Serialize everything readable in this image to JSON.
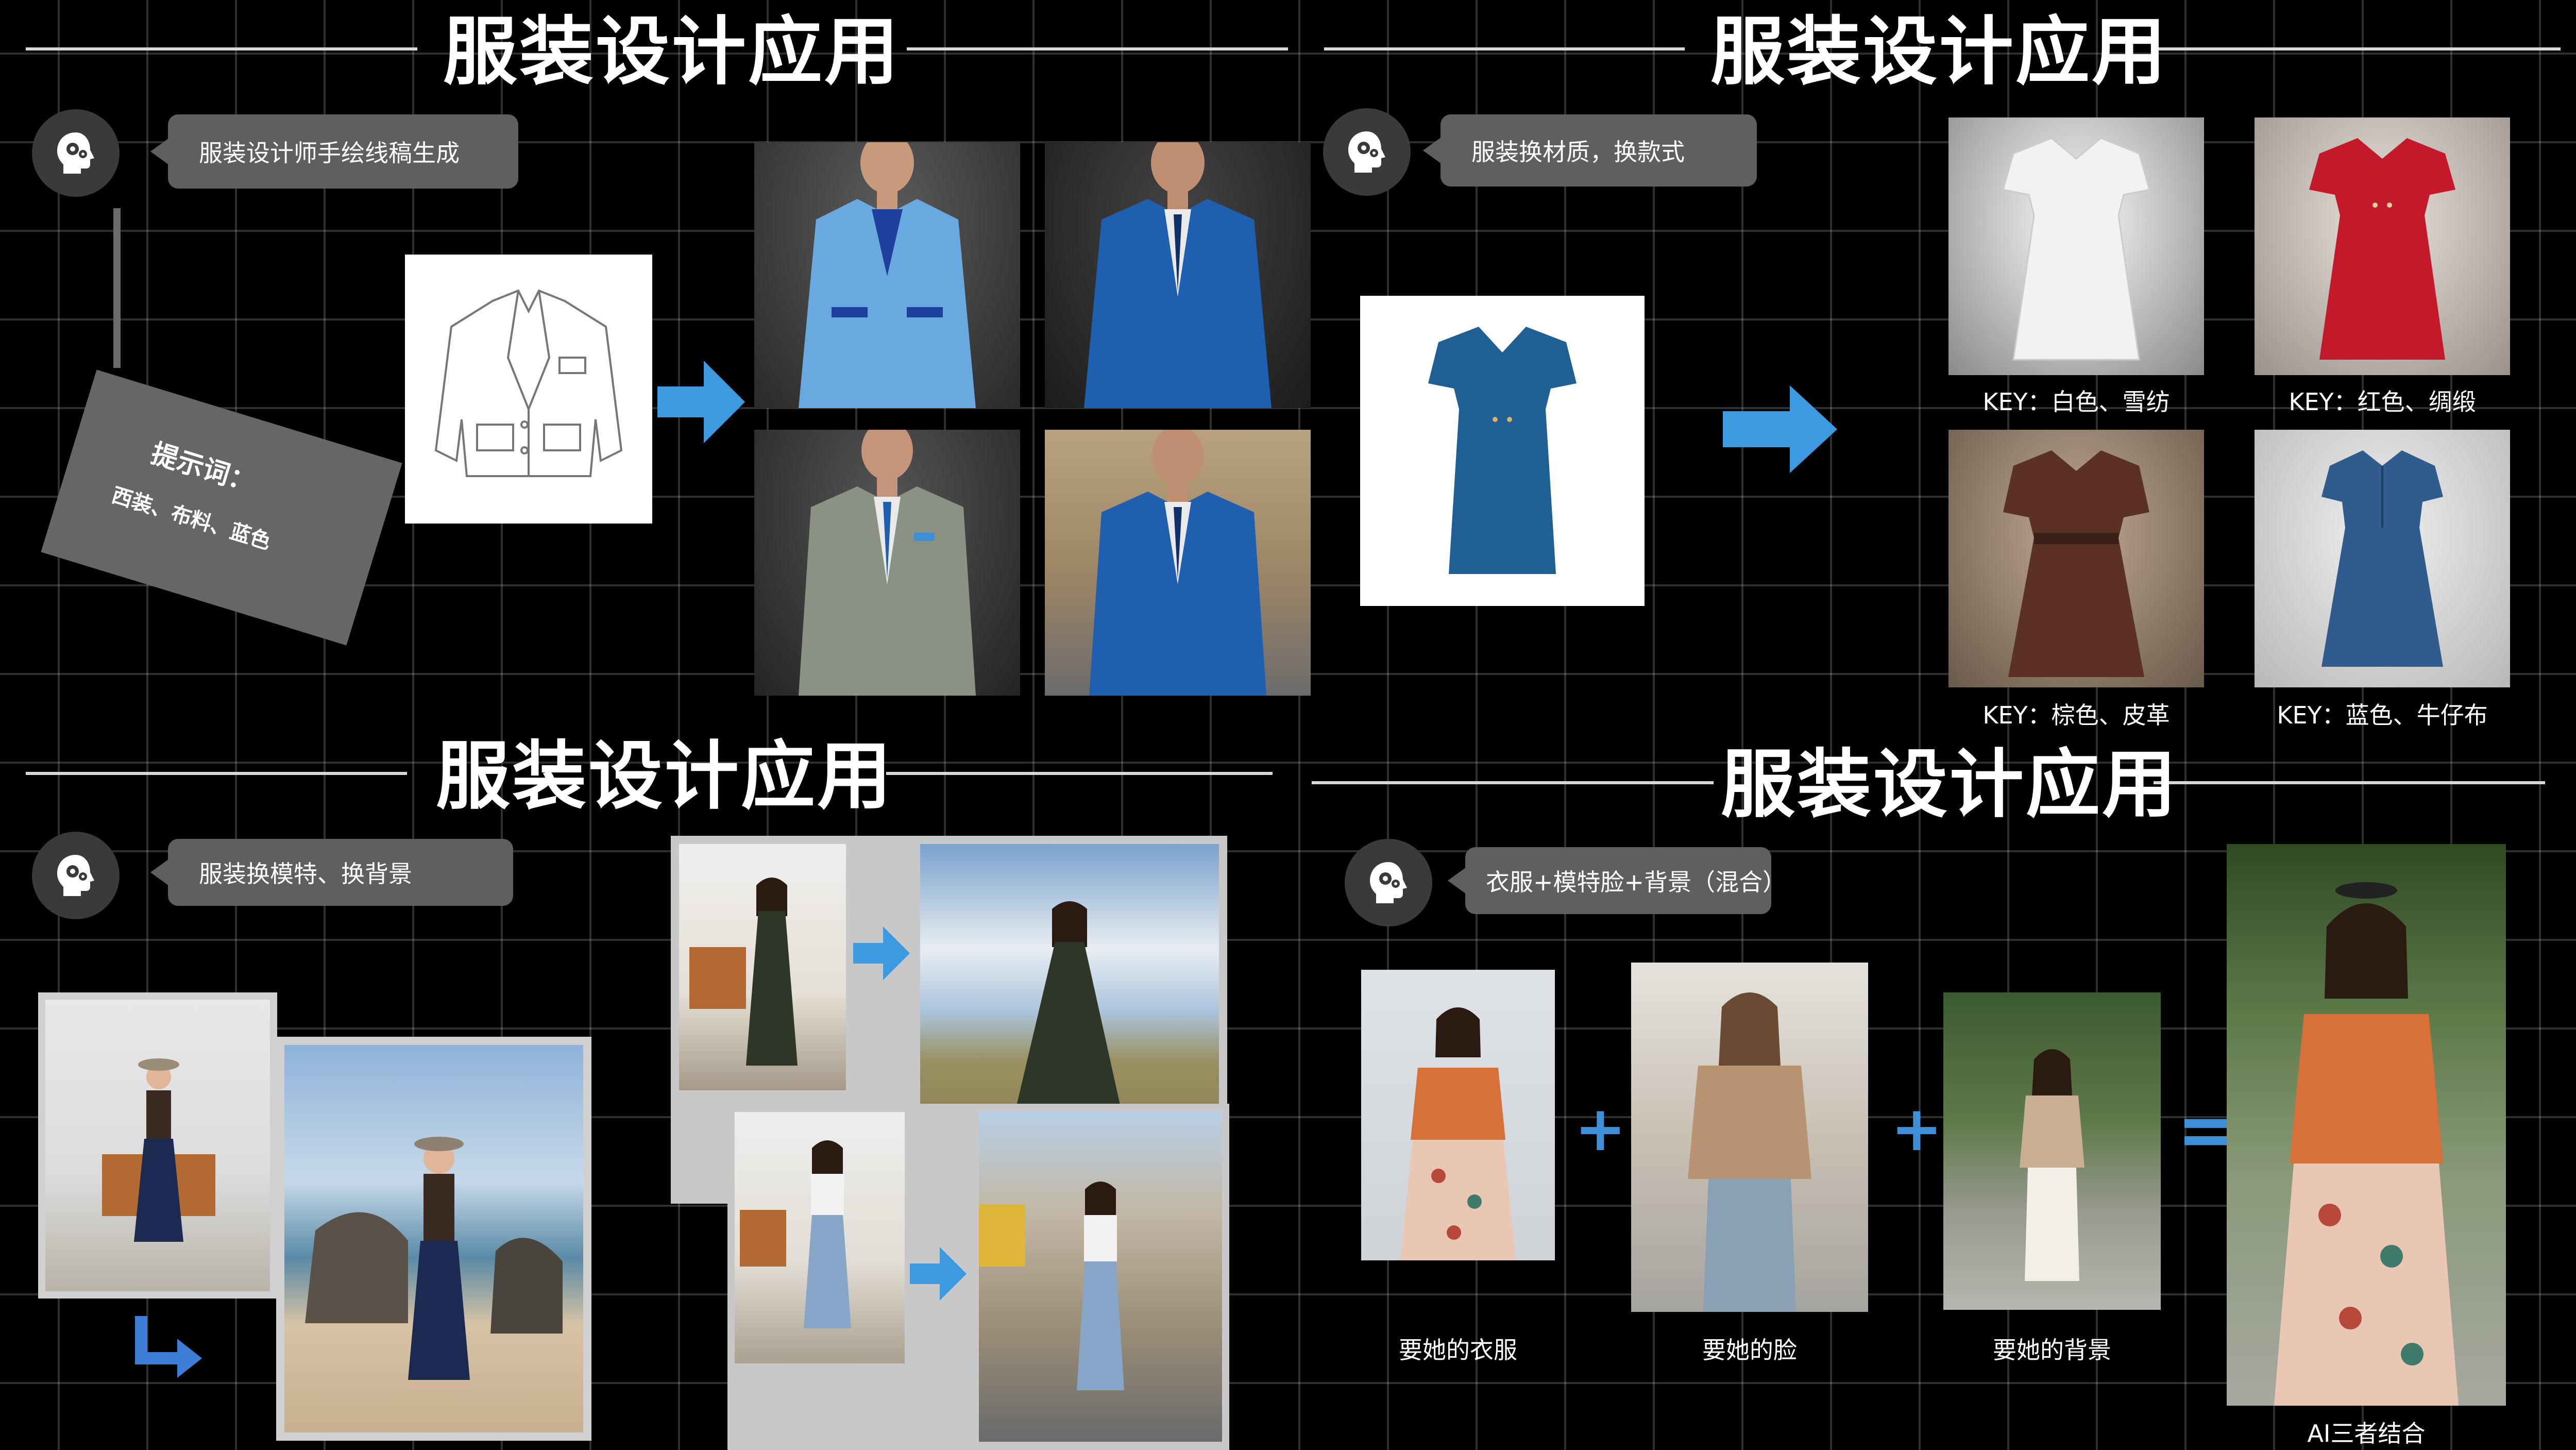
{
  "panels": {
    "top_left": {
      "title": "服装设计应用",
      "bubble": "服装设计师手绘线稿生成",
      "prompt_title": "提示词：",
      "prompt_text": "西装、布料、蓝色"
    },
    "top_right": {
      "title": "服装设计应用",
      "bubble": "服装换材质，换款式",
      "captions": [
        "KEY：白色、雪纺",
        "KEY：红色、绸缎",
        "KEY：棕色、皮革",
        "KEY：蓝色、牛仔布"
      ]
    },
    "bottom_left": {
      "title": "服装设计应用",
      "bubble": "服装换模特、换背景"
    },
    "bottom_right": {
      "title": "服装设计应用",
      "bubble": "衣服+模特脸+背景（混合）",
      "captions": [
        "要她的衣服",
        "要她的脸",
        "要她的背景",
        "AI三者结合"
      ],
      "plus": "+",
      "equals": "="
    }
  },
  "colors": {
    "background": "#000000",
    "bubble": "#5f5f5f",
    "accent_arrow": "#3d9ae0",
    "suit_light_blue": "#6aa8e0",
    "suit_royal_blue": "#1f5fb0",
    "suit_grey": "#8c9283",
    "dress_teal": "#1f5f93",
    "dress_white": "#f2f2f2",
    "dress_red": "#c4192b",
    "dress_brown": "#5a3122",
    "dress_denim": "#2f5c8c",
    "blouse_orange": "#d8703a"
  },
  "icons": [
    "head-gear-icon",
    "arrow-right-icon",
    "arrow-down-right-icon"
  ]
}
